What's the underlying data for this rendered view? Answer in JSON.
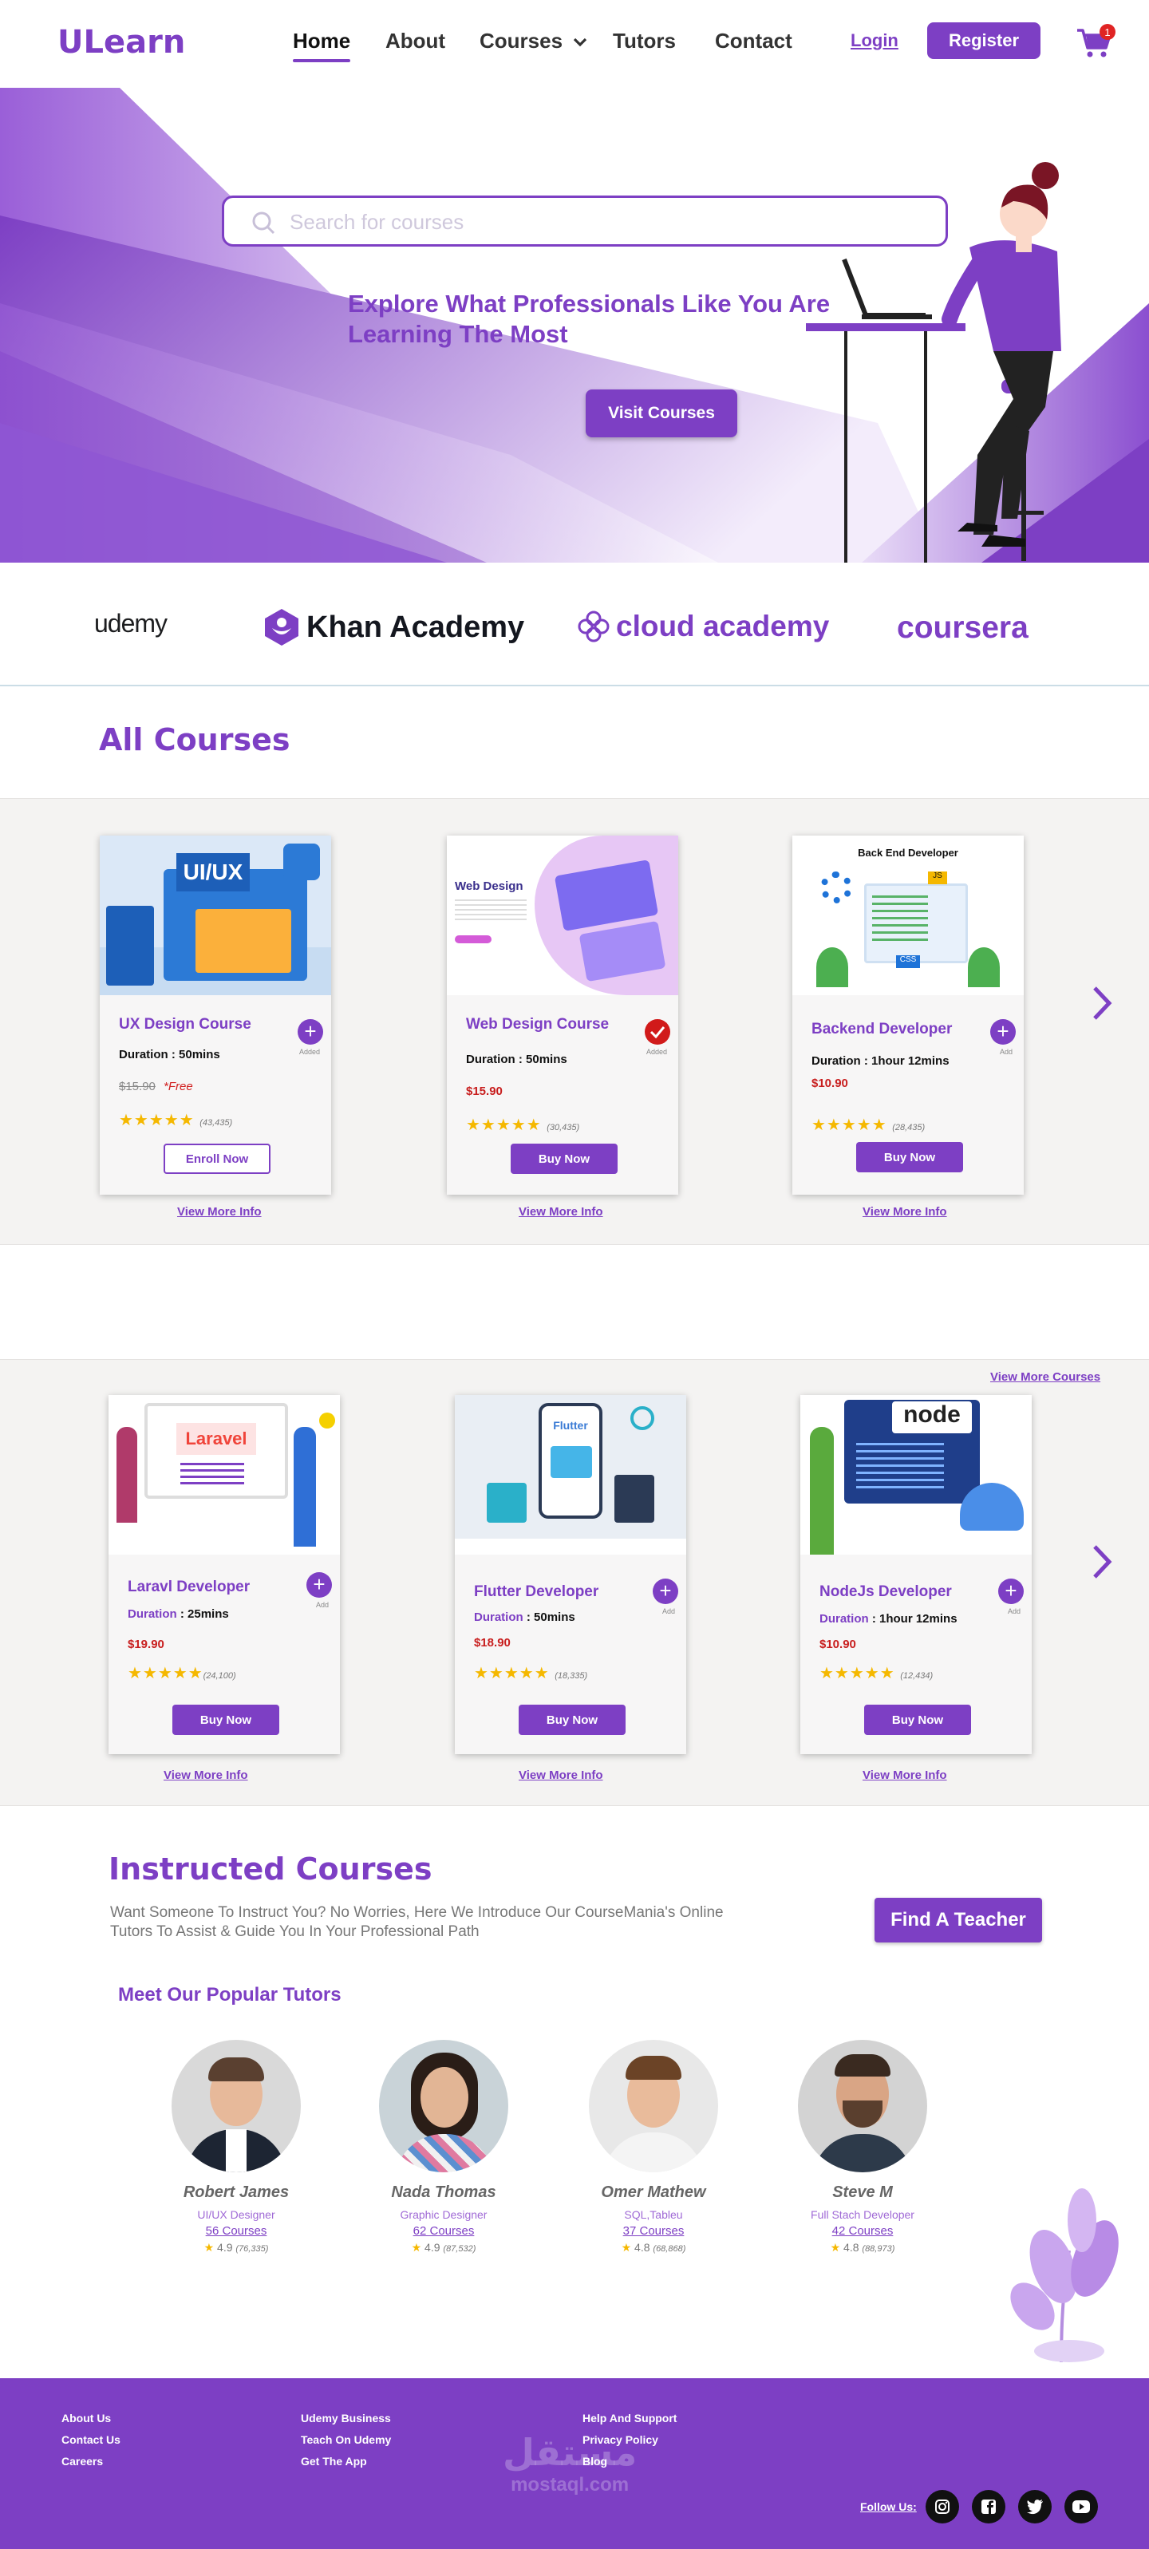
{
  "header": {
    "logo": "ULearn",
    "nav": [
      "Home",
      "About",
      "Courses",
      "Tutors",
      "Contact"
    ],
    "login": "Login",
    "register": "Register",
    "cart_count": "1"
  },
  "hero": {
    "search_placeholder": "Search for courses",
    "title": "Explore What Professionals Like You Are Learning The Most",
    "cta": "Visit Courses"
  },
  "partners": [
    "udemy",
    "Khan Academy",
    "cloud academy",
    "coursera"
  ],
  "all_courses": {
    "title": "All Courses",
    "cards": [
      {
        "title": "UX Design Course",
        "duration_label": "Duration",
        "duration": ": 50mins",
        "old_price": "$15.90",
        "price": "*Free",
        "rating_count": "(43,435)",
        "button": "Enroll Now",
        "status": "Added",
        "image_text": "UI/UX",
        "more": "View More Info"
      },
      {
        "title": "Web Design Course",
        "duration_label": "Duration",
        "duration": ": 50mins",
        "price": "$15.90",
        "rating_count": "(30,435)",
        "button": "Buy Now",
        "status": "Added",
        "image_text": "Web Design",
        "more": "View More Info"
      },
      {
        "title": "Backend Developer",
        "duration_label": "Duration",
        "duration": ": 1hour 12mins",
        "price": "$10.90",
        "rating_count": "(28,435)",
        "button": "Buy Now",
        "status": "Add",
        "image_text": "Back End Developer",
        "more": "View More Info"
      }
    ]
  },
  "more_courses": {
    "view_more": "View More Courses",
    "cards": [
      {
        "title": "Laravl Developer",
        "duration_label": "Duration",
        "duration": ": 25mins",
        "price": "$19.90",
        "rating_count": "(24,100)",
        "button": "Buy Now",
        "status": "Add",
        "image_text": "Laravel",
        "more": "View More Info"
      },
      {
        "title": "Flutter Developer",
        "duration_label": "Duration",
        "duration": ": 50mins",
        "price": "$18.90",
        "rating_count": "(18,335)",
        "button": "Buy Now",
        "status": "Add",
        "image_text": "Flutter",
        "more": "View More Info"
      },
      {
        "title": "NodeJs Developer",
        "duration_label": "Duration",
        "duration": ": 1hour 12mins",
        "price": "$10.90",
        "rating_count": "(12,434)",
        "button": "Buy Now",
        "status": "Add",
        "image_text": "node",
        "more": "View More Info"
      }
    ]
  },
  "instructed": {
    "title": "Instructed Courses",
    "text": "Want Someone To Instruct You? No Worries, Here We Introduce Our CourseMania's Online Tutors  To Assist & Guide You In Your Professional  Path",
    "button": "Find A Teacher",
    "tutors_title": "Meet Our Popular Tutors",
    "tutors": [
      {
        "name": "Robert James",
        "role": "UI/UX Designer",
        "courses": "56 Courses",
        "rating": "4.9",
        "count": "(76,335)"
      },
      {
        "name": "Nada Thomas",
        "role": "Graphic Designer",
        "courses": "62 Courses",
        "rating": "4.9",
        "count": "(87,532)"
      },
      {
        "name": "Omer Mathew",
        "role": "SQL,Tableu",
        "courses": "37 Courses",
        "rating": "4.8",
        "count": "(68,868)"
      },
      {
        "name": "Steve M",
        "role": "Full Stach Developer",
        "courses": "42 Courses",
        "rating": "4.8",
        "count": "(88,973)"
      }
    ]
  },
  "footer": {
    "col1": [
      "About Us",
      "Contact Us",
      "Careers"
    ],
    "col2": [
      "Udemy Business",
      "Teach On Udemy",
      "Get The App"
    ],
    "col3": [
      "Help And Support",
      "Privacy Policy",
      "Blog"
    ],
    "follow": "Follow Us:",
    "watermark_top": "مستقل",
    "watermark_bottom": "mostaql.com"
  },
  "colors": {
    "accent": "#7d3fc4",
    "price": "#c81e1e",
    "star": "#f5b800",
    "band": "#f4f3f2"
  }
}
